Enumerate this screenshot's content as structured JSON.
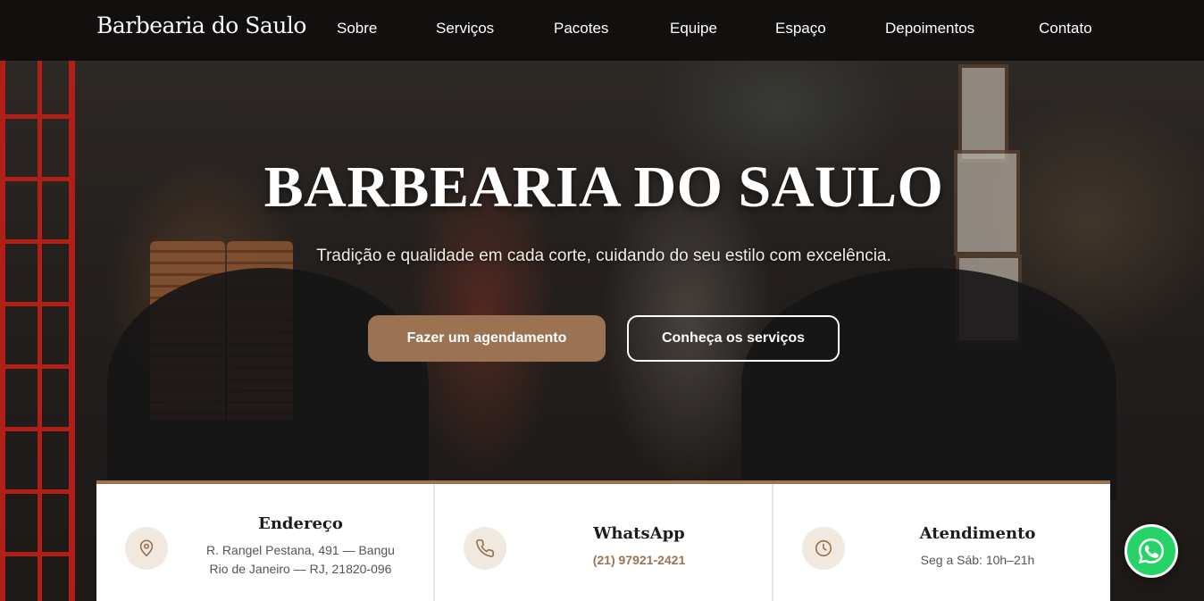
{
  "brand": {
    "name": "Barbearia do Saulo"
  },
  "nav": {
    "items": [
      {
        "label": "Sobre"
      },
      {
        "label": "Serviços"
      },
      {
        "label": "Pacotes"
      },
      {
        "label": "Equipe"
      },
      {
        "label": "Espaço"
      },
      {
        "label": "Depoimentos"
      },
      {
        "label": "Contato"
      }
    ]
  },
  "hero": {
    "title": "BARBEARIA DO SAULO",
    "subtitle": "Tradição e qualidade em cada corte, cuidando do seu estilo com excelência.",
    "primary_button": "Fazer um agendamento",
    "secondary_button": "Conheça os serviços"
  },
  "info": {
    "address": {
      "title": "Endereço",
      "line1": "R. Rangel Pestana, 491 — Bangu",
      "line2": "Rio de Janeiro — RJ, 21820-096",
      "icon": "map-pin-icon"
    },
    "whatsapp": {
      "title": "WhatsApp",
      "phone": "(21) 97921-2421",
      "icon": "phone-icon"
    },
    "hours": {
      "title": "Atendimento",
      "text": "Seg a Sáb: 10h–21h",
      "icon": "clock-icon"
    }
  },
  "colors": {
    "accent": "#9c7352",
    "nav_background": "#0c0a0a",
    "whatsapp": "#25d366"
  }
}
